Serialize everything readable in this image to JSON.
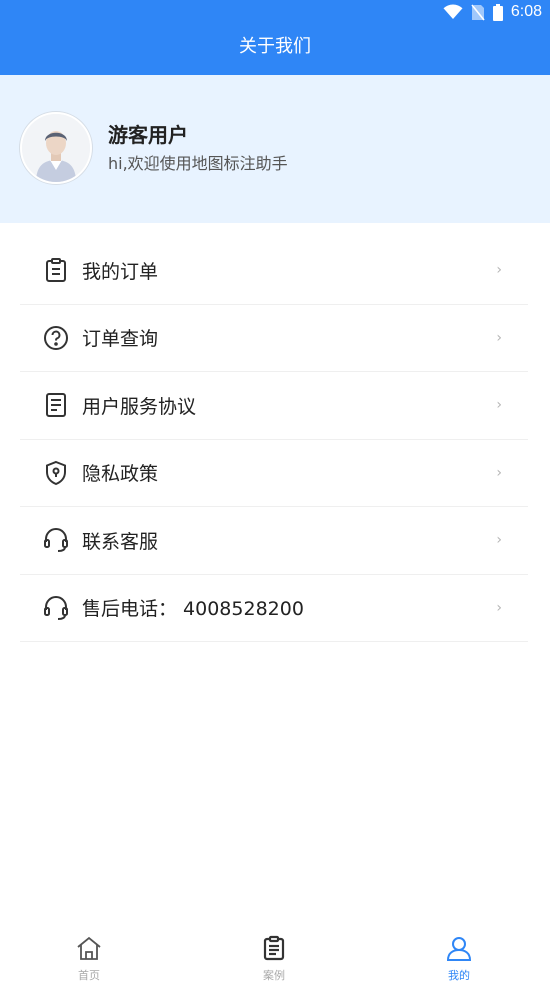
{
  "status_bar": {
    "time": "6:08"
  },
  "header": {
    "title": "关于我们"
  },
  "profile": {
    "name": "游客用户",
    "subtitle": "hi,欢迎使用地图标注助手"
  },
  "menu": [
    {
      "label": "我的订单",
      "icon": "clipboard-icon"
    },
    {
      "label": "订单查询",
      "icon": "question-circle-icon"
    },
    {
      "label": "用户服务协议",
      "icon": "document-icon"
    },
    {
      "label": "隐私政策",
      "icon": "shield-icon"
    },
    {
      "label": "联系客服",
      "icon": "headset-icon"
    },
    {
      "label": "售后电话：  4008528200",
      "icon": "headset-icon"
    }
  ],
  "chevron": "›",
  "tabs": [
    {
      "label": "首页",
      "icon": "home-icon"
    },
    {
      "label": "案例",
      "icon": "clipboard-icon"
    },
    {
      "label": "我的",
      "icon": "user-icon",
      "active": true
    }
  ],
  "colors": {
    "primary": "#2f86f6",
    "profile_bg": "#e8f3ff"
  }
}
